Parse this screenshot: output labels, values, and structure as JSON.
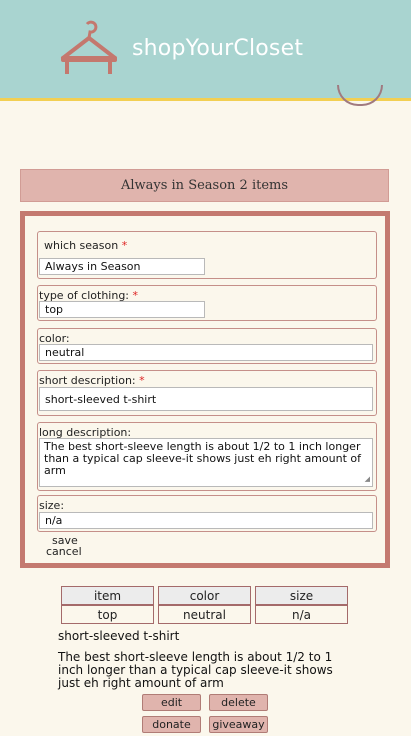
{
  "app": {
    "brand": "shopYourCloset",
    "colors": {
      "header": "#a9d4d0",
      "accent_line": "#f2cf52",
      "panel_border": "#c47a70",
      "button": "#e0b4ad",
      "required": "#dd2222"
    }
  },
  "icons": {
    "logo": "hanger-icon"
  },
  "banner": {
    "text": "Always in Season 2 items"
  },
  "form": {
    "season": {
      "label": "which season",
      "required": "*",
      "value": "Always in Season"
    },
    "clothing_type": {
      "label": "type of clothing:",
      "required": "*",
      "value": "top"
    },
    "color": {
      "label": "color:",
      "value": "neutral"
    },
    "short_description": {
      "label": "short description:",
      "required": "*",
      "value": "short-sleeved t-shirt"
    },
    "long_description": {
      "label": "long description:",
      "value": "The best short-sleeve length is about 1/2 to 1 inch longer than a typical cap sleeve-it shows just eh right amount of arm"
    },
    "size": {
      "label": "size:",
      "value": "n/a"
    },
    "save_label": "save",
    "cancel_label": "cancel"
  },
  "table": {
    "headers": [
      "item",
      "color",
      "size"
    ],
    "row": [
      "top",
      "neutral",
      "n/a"
    ]
  },
  "detail": {
    "title": "short-sleeved t-shirt",
    "description": "The best short-sleeve length is about 1/2 to 1 inch longer than a typical cap sleeve-it shows just eh right amount of arm"
  },
  "actions": {
    "edit": "edit",
    "delete": "delete",
    "donate": "donate",
    "giveaway": "giveaway"
  }
}
